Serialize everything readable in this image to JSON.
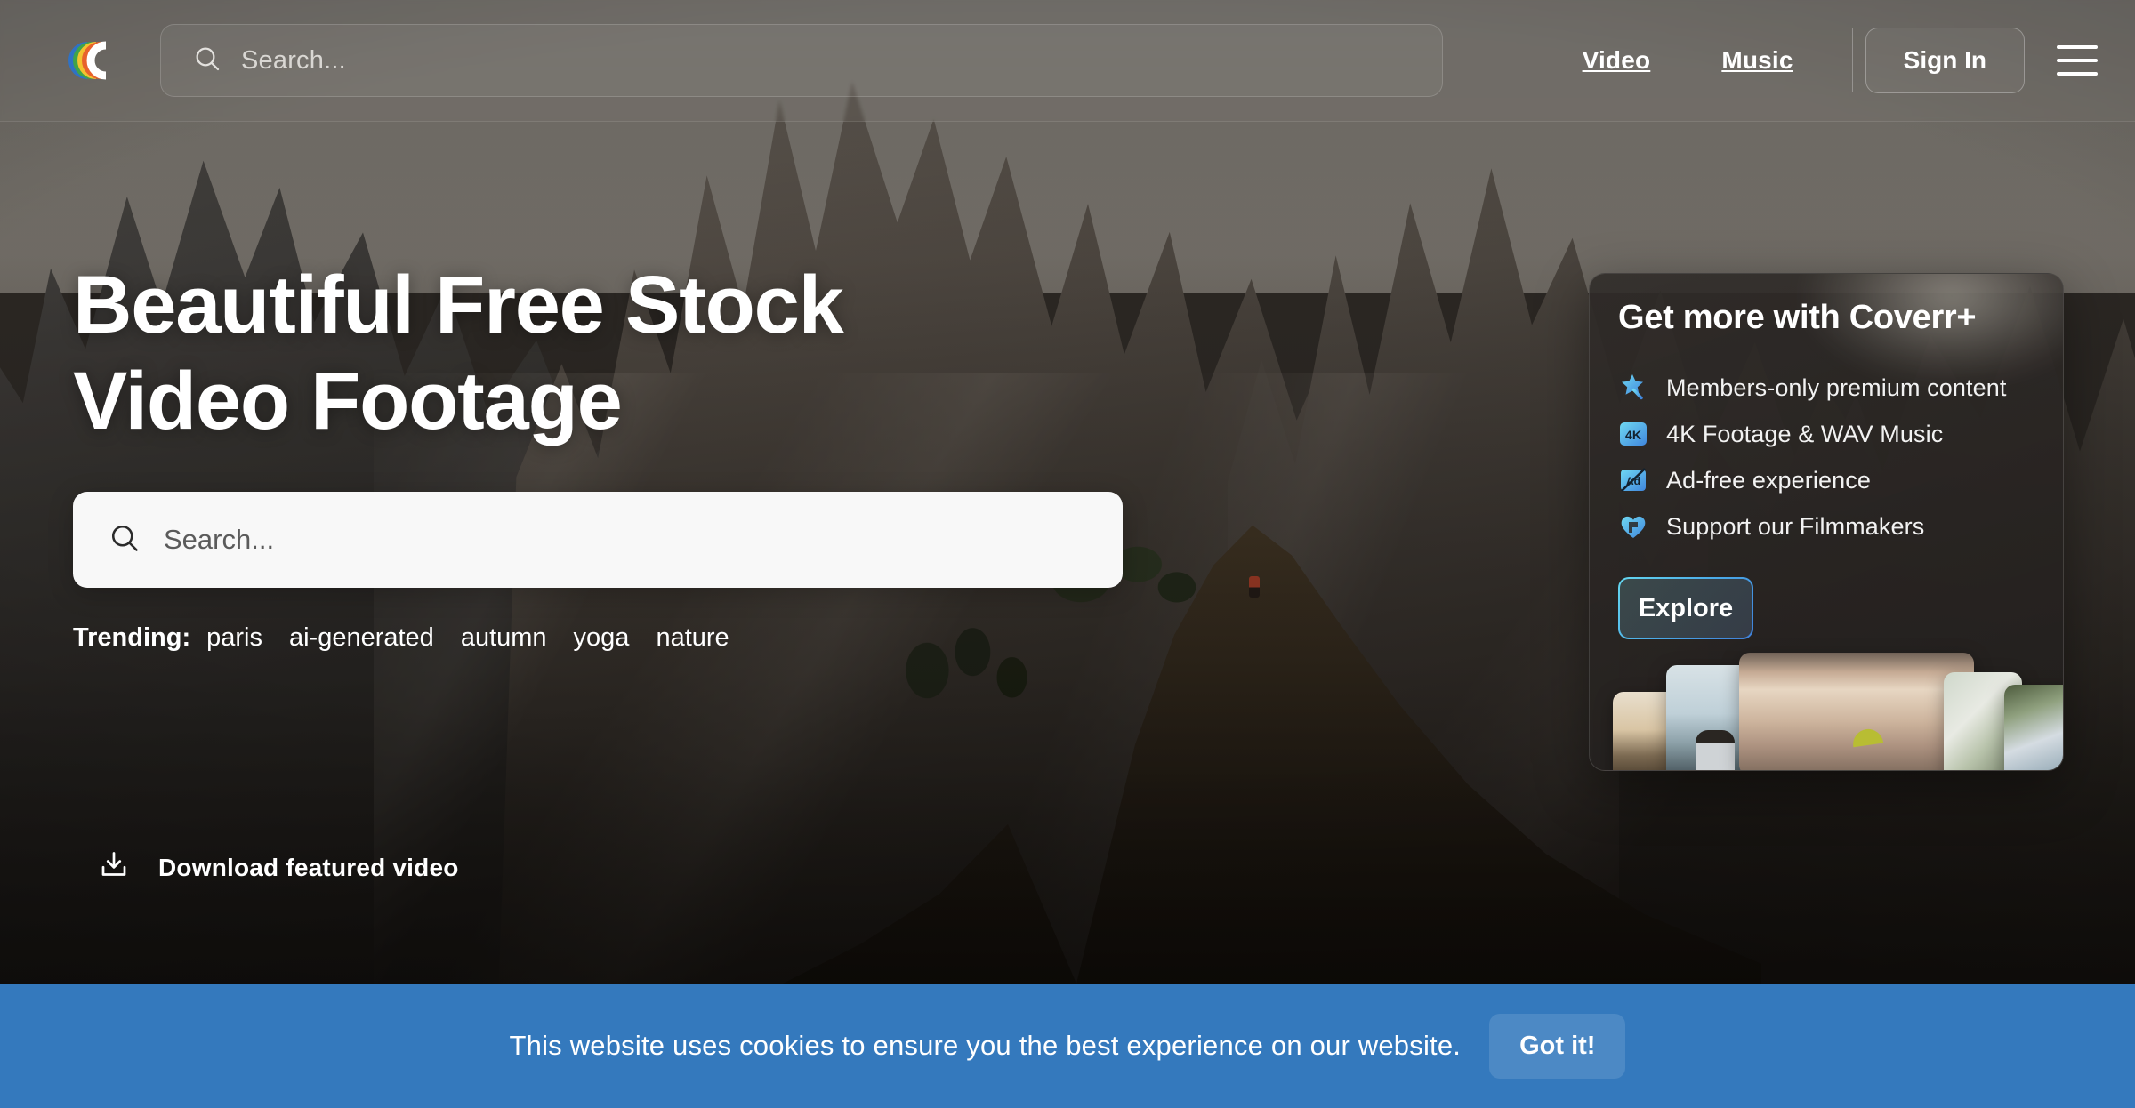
{
  "header": {
    "logo_icon": "coverr-rainbow-c-logo",
    "search": {
      "icon": "search-icon",
      "placeholder": "Search...",
      "value": ""
    },
    "nav": [
      {
        "label": "Video"
      },
      {
        "label": "Music"
      }
    ],
    "sign_in_label": "Sign In",
    "menu_icon": "hamburger-menu-icon"
  },
  "hero": {
    "title_line1": "Beautiful Free Stock",
    "title_line2": "Video Footage",
    "search": {
      "icon": "search-icon",
      "placeholder": "Search...",
      "value": ""
    },
    "trending_label": "Trending:",
    "trending_tags": [
      "paris",
      "ai-generated",
      "autumn",
      "yoga",
      "nature"
    ],
    "download": {
      "icon": "download-icon",
      "label": "Download featured video"
    }
  },
  "promo": {
    "title": "Get more with Coverr+",
    "features": [
      {
        "icon": "magic-wand-star-icon",
        "label": "Members-only premium content"
      },
      {
        "icon": "4k-badge-icon",
        "label": "4K Footage & WAV Music"
      },
      {
        "icon": "ad-free-icon",
        "label": "Ad-free experience"
      },
      {
        "icon": "heart-support-icon",
        "label": "Support our Filmmakers"
      }
    ],
    "explore_label": "Explore",
    "thumbnails": [
      {
        "name": "thumbnail-sunset"
      },
      {
        "name": "thumbnail-person-sea"
      },
      {
        "name": "thumbnail-beach-paraglider"
      },
      {
        "name": "thumbnail-white-building"
      },
      {
        "name": "thumbnail-house-trees"
      }
    ]
  },
  "cookie": {
    "message": "This website uses cookies to ensure you the best experience on our website.",
    "accept_label": "Got it!",
    "background_color": "#3479bd"
  },
  "colors": {
    "accent_cyan": "#64d7ef",
    "accent_blue": "#3f7fd8",
    "cookie_blue": "#3479bd"
  }
}
